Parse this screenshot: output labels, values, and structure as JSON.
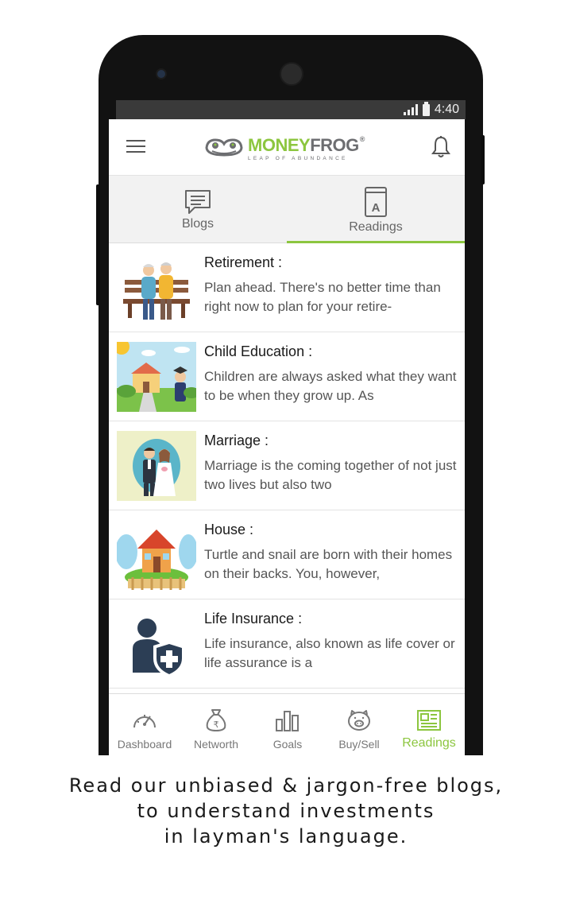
{
  "status_bar": {
    "time": "4:40"
  },
  "app": {
    "logo_money": "MONEY",
    "logo_frog": "FROG",
    "logo_reg": "®",
    "logo_tagline": "LEAP OF ABUNDANCE",
    "menu_icon": "hamburger-icon",
    "notification_icon": "bell-icon"
  },
  "tabs": [
    {
      "label": "Blogs",
      "icon": "blog-icon",
      "active": false
    },
    {
      "label": "Readings",
      "icon": "book-icon",
      "active": true
    }
  ],
  "readings": [
    {
      "title": "Retirement :",
      "description": "Plan ahead. There's no better time than right now to plan for your retire-",
      "image": "elderly-couple-bench-image"
    },
    {
      "title": "Child Education :",
      "description": "Children are always asked what they want to be when they grow up. As",
      "image": "school-graduate-image"
    },
    {
      "title": "Marriage :",
      "description": "Marriage is the coming together of not just two lives but also two",
      "image": "wedding-couple-image"
    },
    {
      "title": "House :",
      "description": "Turtle and snail are born with their homes on their backs. You, however,",
      "image": "cottage-house-image"
    },
    {
      "title": "Life Insurance :",
      "description": "Life insurance, also known as life cover or life assurance is a",
      "image": "person-shield-image"
    }
  ],
  "bottom_nav": [
    {
      "label": "Dashboard",
      "icon": "speedometer-icon",
      "active": false
    },
    {
      "label": "Networth",
      "icon": "money-bag-icon",
      "active": false
    },
    {
      "label": "Goals",
      "icon": "bar-chart-icon",
      "active": false
    },
    {
      "label": "Buy/Sell",
      "icon": "piggy-bank-icon",
      "active": false
    },
    {
      "label": "Readings",
      "icon": "newspaper-icon",
      "active": true
    }
  ],
  "caption": {
    "line1": "Read our unbiased & jargon-free blogs,",
    "line2": "to understand investments",
    "line3": "in layman's language."
  },
  "colors": {
    "accent": "#8cc63f",
    "logo_grey": "#6d6e71",
    "device": "#121212"
  }
}
